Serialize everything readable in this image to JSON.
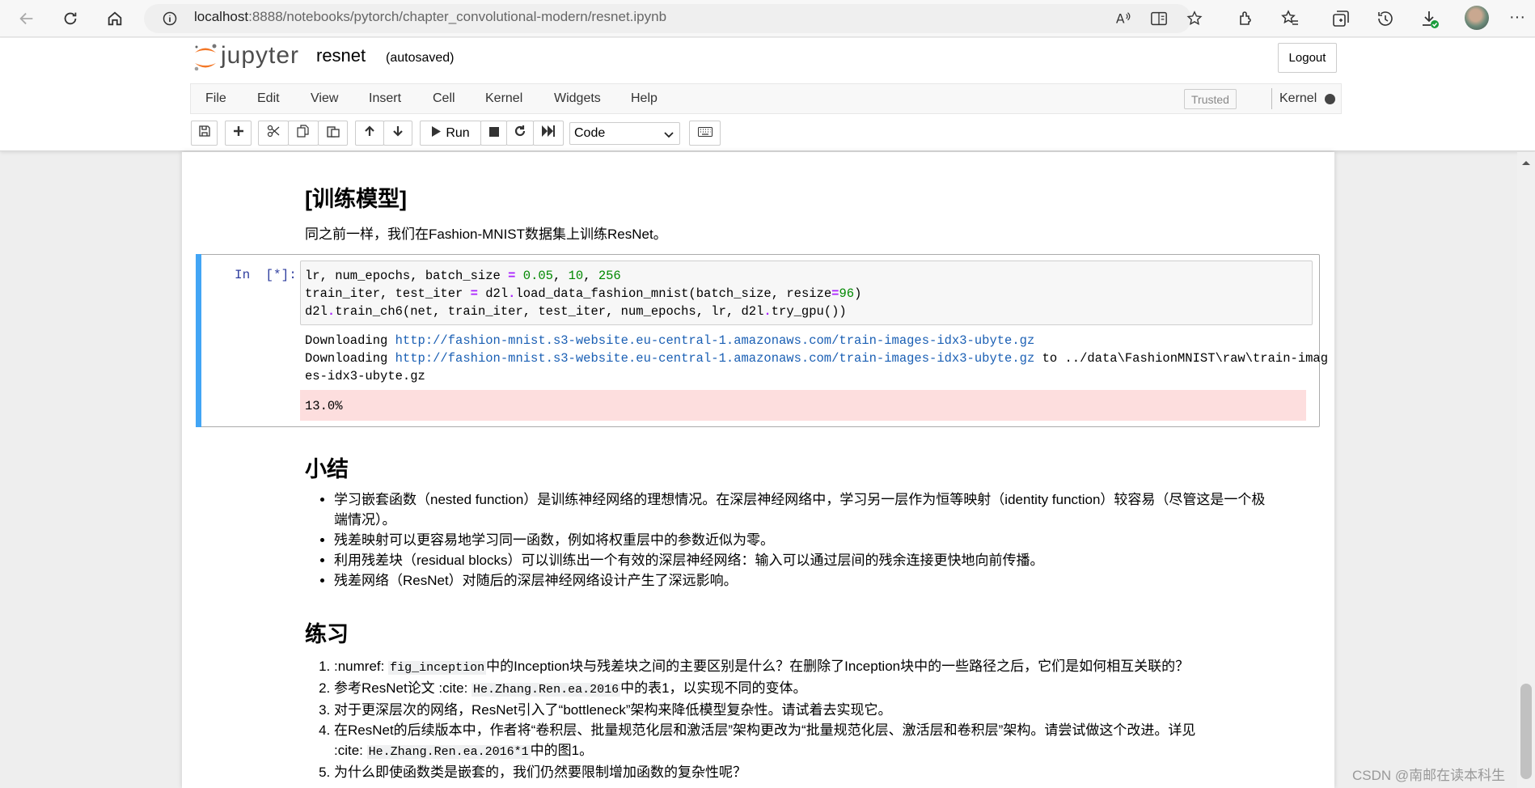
{
  "browser": {
    "url_host": "localhost",
    "url_path": ":8888/notebooks/pytorch/chapter_convolutional-modern/resnet.ipynb"
  },
  "jupyter": {
    "logo_text": "jupyter",
    "notebook_name": "resnet",
    "autosave_status": "(autosaved)",
    "logout_label": "Logout",
    "menu": [
      "File",
      "Edit",
      "View",
      "Insert",
      "Cell",
      "Kernel",
      "Widgets",
      "Help"
    ],
    "trusted_label": "Trusted",
    "kernel_label": "Kernel",
    "run_label": "Run",
    "cell_type": "Code"
  },
  "content": {
    "train_heading": "[训练模型]",
    "train_para": "同之前一样，我们在Fashion-MNIST数据集上训练ResNet。",
    "prompt": "In  [*]:",
    "code_lines": [
      "lr, num_epochs, batch_size = 0.05, 10, 256",
      "train_iter, test_iter = d2l.load_data_fashion_mnist(batch_size, resize=96)",
      "d2l.train_ch6(net, train_iter, test_iter, num_epochs, lr, d2l.try_gpu())"
    ],
    "output": {
      "downloading": "Downloading ",
      "url": "http://fashion-mnist.s3-website.eu-central-1.amazonaws.com/train-images-idx3-ubyte.gz",
      "to_path": " to ../data\\FashionMNIST\\raw\\train-imag",
      "to_path_cont": "es-idx3-ubyte.gz",
      "progress": "13.0%"
    },
    "summary_heading": "小结",
    "summary_items": [
      "学习嵌套函数（nested function）是训练神经网络的理想情况。在深层神经网络中，学习另一层作为恒等映射（identity function）较容易（尽管这是一个极",
      "端情况）。",
      "残差映射可以更容易地学习同一函数，例如将权重层中的参数近似为零。",
      "利用残差块（residual blocks）可以训练出一个有效的深层神经网络：输入可以通过层间的残余连接更快地向前传播。",
      "残差网络（ResNet）对随后的深层神经网络设计产生了深远影响。"
    ],
    "exercise_heading": "练习",
    "exercises": {
      "e1_a": ":numref: ",
      "e1_code": "fig_inception",
      "e1_b": "中的Inception块与残差块之间的主要区别是什么？在删除了Inception块中的一些路径之后，它们是如何相互关联的？",
      "e2_a": "参考ResNet论文 :cite: ",
      "e2_code": "He.Zhang.Ren.ea.2016",
      "e2_b": "中的表1，以实现不同的变体。",
      "e3": "对于更深层次的网络，ResNet引入了“bottleneck”架构来降低模型复杂性。请试着去实现它。",
      "e4_a": "在ResNet的后续版本中，作者将“卷积层、批量规范化层和激活层”架构更改为“批量规范化层、激活层和卷积层”架构。请尝试做这个改进。详见",
      "e4_b": ":cite: ",
      "e4_code": "He.Zhang.Ren.ea.2016*1",
      "e4_c": "中的图1。",
      "e5": "为什么即使函数类是嵌套的，我们仍然要限制增加函数的复杂性呢？"
    }
  },
  "watermark": "CSDN @南邮在读本科生",
  "icons": [
    "back-icon",
    "refresh-icon",
    "home-icon",
    "info-icon",
    "read-aloud-icon",
    "immersive-reader-icon",
    "favorite-add-icon",
    "extensions-icon",
    "favorites-icon",
    "collections-icon",
    "history-icon",
    "downloads-icon",
    "profile-avatar",
    "more-icon",
    "save-icon",
    "plus-icon",
    "cut-icon",
    "copy-icon",
    "paste-icon",
    "arrow-up-icon",
    "arrow-down-icon",
    "play-icon",
    "stop-icon",
    "restart-icon",
    "fast-forward-icon",
    "keyboard-icon"
  ]
}
